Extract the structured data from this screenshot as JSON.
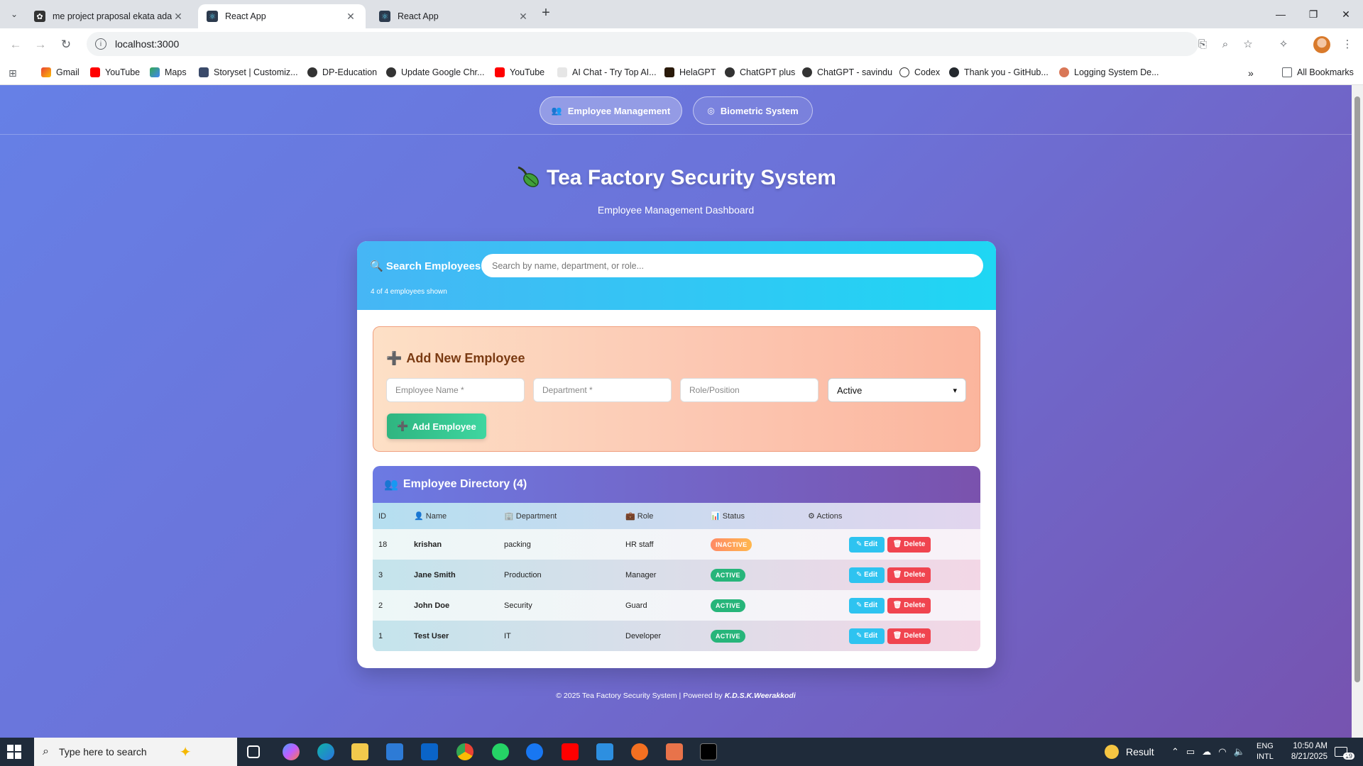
{
  "browser": {
    "tabs": [
      {
        "title": "me project praposal ekata adala"
      },
      {
        "title": "React App"
      },
      {
        "title": "React App"
      }
    ],
    "url": "localhost:3000",
    "bookmarks": [
      "Gmail",
      "YouTube",
      "Maps",
      "Storyset | Customiz...",
      "DP-Education",
      "Update Google Chr...",
      "YouTube",
      "AI Chat - Try Top AI...",
      "HelaGPT",
      "ChatGPT plus",
      "ChatGPT - savindu",
      "Codex",
      "Thank you - GitHub...",
      "Logging System De..."
    ],
    "all_bookmarks": "All Bookmarks"
  },
  "nav": {
    "employee_management": "Employee Management",
    "biometric_system": "Biometric System"
  },
  "hero": {
    "title": "Tea Factory Security System",
    "subtitle": "Employee Management Dashboard"
  },
  "search": {
    "label": "Search Employees:",
    "placeholder": "Search by name, department, or role...",
    "count": "4 of 4 employees shown"
  },
  "add_form": {
    "title": "Add New Employee",
    "name_placeholder": "Employee Name *",
    "department_placeholder": "Department *",
    "role_placeholder": "Role/Position",
    "status_value": "Active",
    "button": "Add Employee"
  },
  "directory": {
    "title": "Employee Directory (4)",
    "columns": [
      "ID",
      "Name",
      "Department",
      "Role",
      "Status",
      "Actions"
    ],
    "rows": [
      {
        "id": "18",
        "name": "krishan",
        "department": "packing",
        "role": "HR staff",
        "status": "INACTIVE"
      },
      {
        "id": "3",
        "name": "Jane Smith",
        "department": "Production",
        "role": "Manager",
        "status": "ACTIVE"
      },
      {
        "id": "2",
        "name": "John Doe",
        "department": "Security",
        "role": "Guard",
        "status": "ACTIVE"
      },
      {
        "id": "1",
        "name": "Test User",
        "department": "IT",
        "role": "Developer",
        "status": "ACTIVE"
      }
    ],
    "edit_label": "Edit",
    "delete_label": "Delete"
  },
  "footer": {
    "text": "© 2025 Tea Factory Security System | Powered by ",
    "author": "K.D.S.K.Weerakkodi"
  },
  "taskbar": {
    "search_placeholder": "Type here to search",
    "weather": "Result",
    "lang1": "ENG",
    "lang2": "INTL",
    "time": "10:50 AM",
    "date": "8/21/2025",
    "notifications": "19"
  }
}
